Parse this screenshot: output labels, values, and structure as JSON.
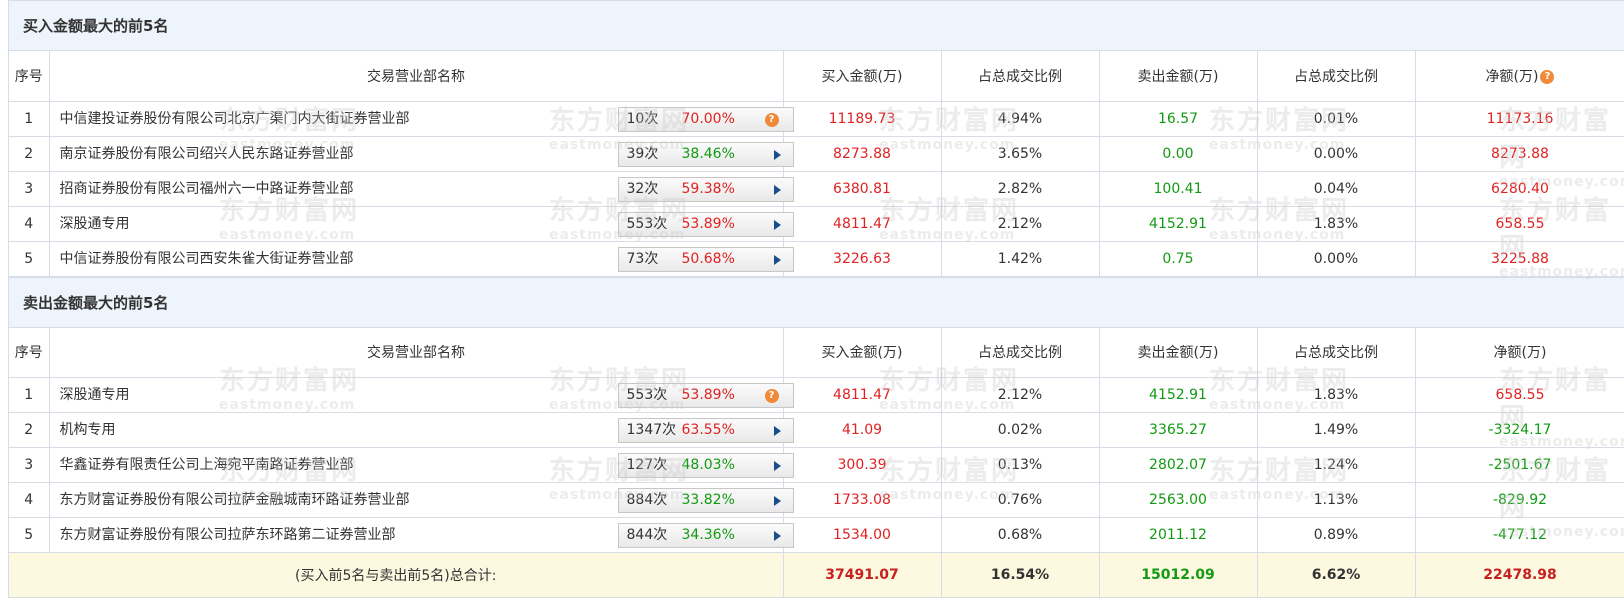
{
  "buy_section": {
    "title": "买入金额最大的前5名",
    "headers": [
      "序号",
      "交易营业部名称",
      "买入金额(万)",
      "占总成交比例",
      "卖出金额(万)",
      "占总成交比例",
      "净额(万)"
    ],
    "rows": [
      {
        "idx": "1",
        "name": "中信建投证券股份有限公司北京广渠门内大街证券营业部",
        "times": "10次",
        "pct": "70.00%",
        "pct_color": "red",
        "badge": "q",
        "buy": "11189.73",
        "buy_pct": "4.94%",
        "sell": "16.57",
        "sell_pct": "0.01%",
        "net": "11173.16",
        "net_color": "red"
      },
      {
        "idx": "2",
        "name": "南京证券股份有限公司绍兴人民东路证券营业部",
        "times": "39次",
        "pct": "38.46%",
        "pct_color": "green",
        "badge": "arrow",
        "buy": "8273.88",
        "buy_pct": "3.65%",
        "sell": "0.00",
        "sell_pct": "0.00%",
        "net": "8273.88",
        "net_color": "red"
      },
      {
        "idx": "3",
        "name": "招商证券股份有限公司福州六一中路证券营业部",
        "times": "32次",
        "pct": "59.38%",
        "pct_color": "red",
        "badge": "arrow",
        "buy": "6380.81",
        "buy_pct": "2.82%",
        "sell": "100.41",
        "sell_pct": "0.04%",
        "net": "6280.40",
        "net_color": "red"
      },
      {
        "idx": "4",
        "name": "深股通专用",
        "times": "553次",
        "pct": "53.89%",
        "pct_color": "red",
        "badge": "arrow",
        "buy": "4811.47",
        "buy_pct": "2.12%",
        "sell": "4152.91",
        "sell_pct": "1.83%",
        "net": "658.55",
        "net_color": "red"
      },
      {
        "idx": "5",
        "name": "中信证券股份有限公司西安朱雀大街证券营业部",
        "times": "73次",
        "pct": "50.68%",
        "pct_color": "red",
        "badge": "arrow",
        "buy": "3226.63",
        "buy_pct": "1.42%",
        "sell": "0.75",
        "sell_pct": "0.00%",
        "net": "3225.88",
        "net_color": "red"
      }
    ]
  },
  "sell_section": {
    "title": "卖出金额最大的前5名",
    "headers": [
      "序号",
      "交易营业部名称",
      "买入金额(万)",
      "占总成交比例",
      "卖出金额(万)",
      "占总成交比例",
      "净额(万)"
    ],
    "rows": [
      {
        "idx": "1",
        "name": "深股通专用",
        "times": "553次",
        "pct": "53.89%",
        "pct_color": "red",
        "badge": "q",
        "buy": "4811.47",
        "buy_pct": "2.12%",
        "sell": "4152.91",
        "sell_pct": "1.83%",
        "net": "658.55",
        "net_color": "red"
      },
      {
        "idx": "2",
        "name": "机构专用",
        "times": "1347次",
        "pct": "63.55%",
        "pct_color": "red",
        "badge": "arrow",
        "buy": "41.09",
        "buy_pct": "0.02%",
        "sell": "3365.27",
        "sell_pct": "1.49%",
        "net": "-3324.17",
        "net_color": "green"
      },
      {
        "idx": "3",
        "name": "华鑫证券有限责任公司上海宛平南路证券营业部",
        "times": "127次",
        "pct": "48.03%",
        "pct_color": "green",
        "badge": "arrow",
        "buy": "300.39",
        "buy_pct": "0.13%",
        "sell": "2802.07",
        "sell_pct": "1.24%",
        "net": "-2501.67",
        "net_color": "green"
      },
      {
        "idx": "4",
        "name": "东方财富证券股份有限公司拉萨金融城南环路证券营业部",
        "times": "884次",
        "pct": "33.82%",
        "pct_color": "green",
        "badge": "arrow",
        "buy": "1733.08",
        "buy_pct": "0.76%",
        "sell": "2563.00",
        "sell_pct": "1.13%",
        "net": "-829.92",
        "net_color": "green"
      },
      {
        "idx": "5",
        "name": "东方财富证券股份有限公司拉萨东环路第二证券营业部",
        "times": "844次",
        "pct": "34.36%",
        "pct_color": "green",
        "badge": "arrow",
        "buy": "1534.00",
        "buy_pct": "0.68%",
        "sell": "2011.12",
        "sell_pct": "0.89%",
        "net": "-477.12",
        "net_color": "green"
      }
    ]
  },
  "total": {
    "label": "(买入前5名与卖出前5名)总合计:",
    "buy": "37491.07",
    "buy_pct": "16.54%",
    "sell": "15012.09",
    "sell_pct": "6.62%",
    "net": "22478.98"
  },
  "help_glyph": "?",
  "watermark": {
    "cn": "东方财富网",
    "en": "eastmoney.com"
  },
  "colors": {
    "up": "#e02222",
    "down": "#139a13",
    "header_bg": "#eef4fb",
    "total_bg": "#fdf9e0"
  }
}
